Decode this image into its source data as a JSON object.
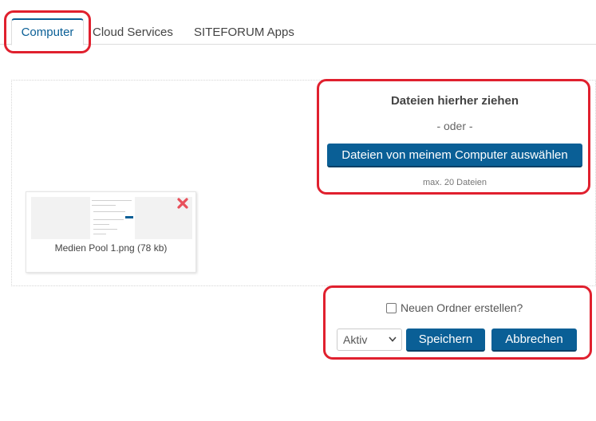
{
  "tabs": [
    {
      "label": "Computer",
      "active": true
    },
    {
      "label": "Cloud Services",
      "active": false
    },
    {
      "label": "SITEFORUM Apps",
      "active": false
    }
  ],
  "dropzone": {
    "title": "Dateien hierher ziehen",
    "or_text": "- oder -",
    "select_button": "Dateien von meinem Computer auswählen",
    "max_files": "max. 20 Dateien"
  },
  "files": [
    {
      "name": "Medien Pool 1.png (78 kb)",
      "delete_icon": "close-x-icon"
    }
  ],
  "controls": {
    "new_folder_label": "Neuen Ordner erstellen?",
    "new_folder_checked": false,
    "status_value": "Aktiv",
    "save_label": "Speichern",
    "cancel_label": "Abbrechen"
  },
  "colors": {
    "accent": "#0a5f96",
    "highlight": "#e0202e",
    "delete": "#e8505b"
  }
}
